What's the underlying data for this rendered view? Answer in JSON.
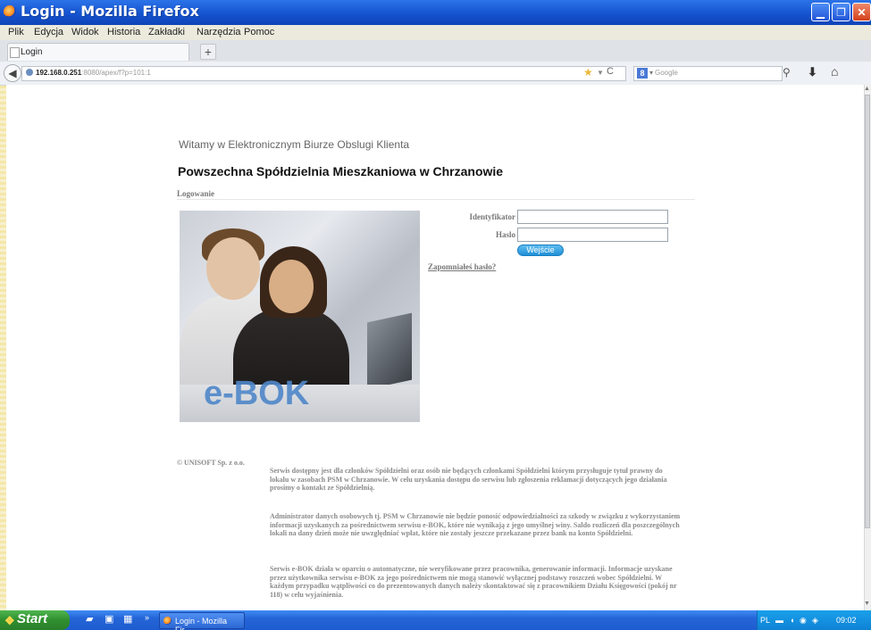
{
  "window": {
    "title": "Login - Mozilla Firefox"
  },
  "menu": [
    "Plik",
    "Edycja",
    "Widok",
    "Historia",
    "Zakładki",
    "Narzędzia",
    "Pomoc"
  ],
  "tabs": [
    {
      "label": "Login"
    }
  ],
  "toolbar": {
    "url_host": "192.168.0.251",
    "url_path": ":8080/apex/f?p=101:1",
    "search_placeholder": "Google",
    "search_engine_letter": "8"
  },
  "page": {
    "welcome": "Witamy w Elektronicznym Biurze Obslugi Klienta",
    "coop_name": "Powszechna Spółdzielnia Mieszkaniowa w Chrzanowie",
    "section": "Logowanie",
    "brand_overlay": "e-BOK",
    "login": {
      "id_label": "Identyfikator",
      "id_value": "",
      "password_label": "Haslo",
      "password_value": "",
      "submit_label": "Wejście",
      "forgot_label": "Zapomniałeś hasło?"
    },
    "footer": {
      "copyright": "© UNISOFT Sp. z o.o.",
      "paragraphs": [
        "Serwis dostępny jest dla członków Spółdzielni oraz osób nie będących członkami Spółdzielni którym przysługuje tytuł prawny do lokalu w zasobach PSM w Chrzanowie. W celu uzyskania dostępu do serwisu lub zgłoszenia reklamacji dotyczących jego działania prosimy o kontakt ze Spółdzielnią.",
        "Administrator danych osobowych tj. PSM w Chrzanowie nie będzie ponosić odpowiedzialności za szkody w związku z wykorzystaniem informacji uzyskanych za pośrednictwem serwisu e-BOK, które nie wynikają z jego umyślnej winy. Saldo rozliczeń dla poszczególnych lokali na dany dzień może nie uwzględniać wpłat, które nie zostały jeszcze przekazane przez bank na konto Spółdzielni.",
        "Serwis e-BOK działa w oparciu o automatyczne, nie weryfikowane przez pracownika, generowanie informacji. Informacje uzyskane przez użytkownika serwisu e-BOK za jego pośrednictwem nie mogą stanowić wyłącznej podstawy roszczeń wobec Spółdzielni. W każdym przypadku wątpliwości co do prezentowanych danych należy skontaktować się z pracownikiem Działu Księgowości (pokój nr 118) w celu wyjaśnienia."
      ]
    }
  },
  "taskbar": {
    "start_label": "Start",
    "task_label": "Login - Mozilla Fir...",
    "lang": "PL",
    "clock": "09:02"
  }
}
